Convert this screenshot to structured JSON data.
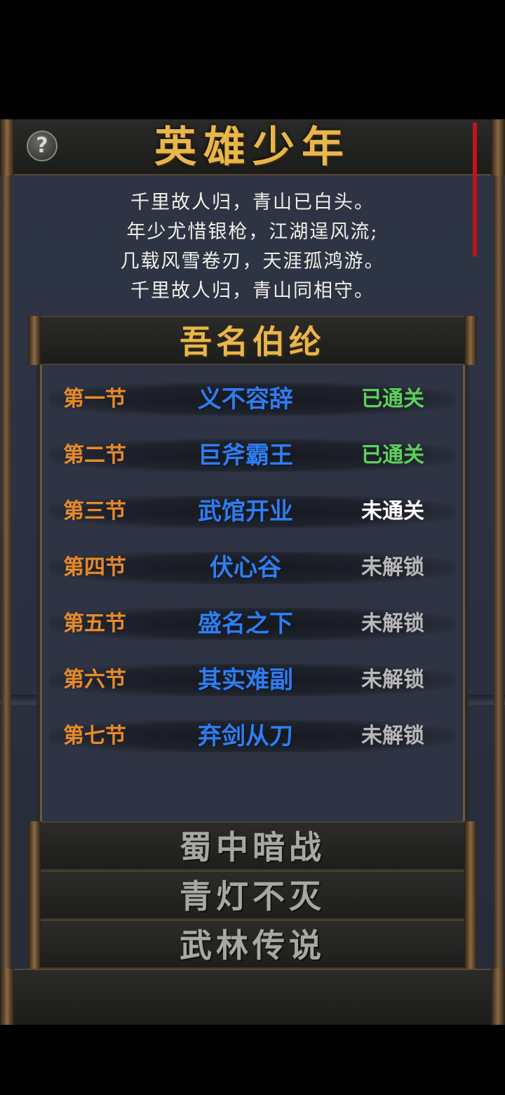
{
  "header": {
    "help_icon": "question-mark-icon",
    "help_glyph": "?",
    "title": "英雄少年"
  },
  "poem": {
    "lines": [
      "千里故人归，青山已白头。",
      "年少尤惜银枪，江湖逞风流;",
      "几载风雪卷刃，天涯孤鸿游。",
      "千里故人归，青山同相守。"
    ]
  },
  "chapter": {
    "title": "吾名伯纶",
    "sections": [
      {
        "num": "第一节",
        "name": "义不容辞",
        "status": "已通关",
        "state": "cleared"
      },
      {
        "num": "第二节",
        "name": "巨斧霸王",
        "status": "已通关",
        "state": "cleared"
      },
      {
        "num": "第三节",
        "name": "武馆开业",
        "status": "未通关",
        "state": "open"
      },
      {
        "num": "第四节",
        "name": "伏心谷",
        "status": "未解锁",
        "state": "locked"
      },
      {
        "num": "第五节",
        "name": "盛名之下",
        "status": "未解锁",
        "state": "locked"
      },
      {
        "num": "第六节",
        "name": "其实难副",
        "status": "未解锁",
        "state": "locked"
      },
      {
        "num": "第七节",
        "name": "弃剑从刀",
        "status": "未解锁",
        "state": "locked"
      }
    ]
  },
  "other_chapters": [
    "蜀中暗战",
    "青灯不灭",
    "武林传说"
  ],
  "colors": {
    "title_gold": "#e8b64a",
    "section_num": "#e88a2a",
    "section_name": "#2e7ef0",
    "cleared": "#5cd05c",
    "open": "#ffffff",
    "locked": "#b8b8b8",
    "scrollbar": "#c0141a"
  }
}
